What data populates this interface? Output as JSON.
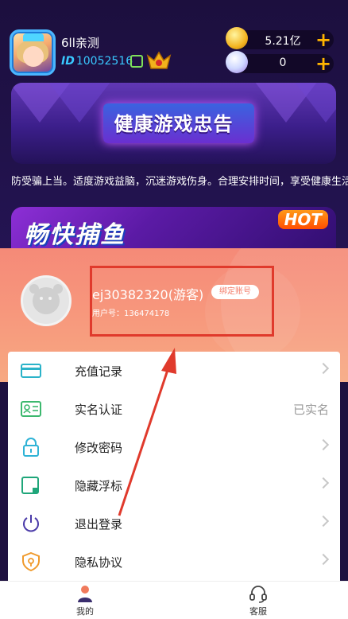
{
  "header": {
    "player_name": "6ll亲测",
    "id_label": "ID",
    "id_value": "10052516",
    "gold_value": "5.21亿",
    "pearl_value": "0",
    "plus": "+"
  },
  "banners": {
    "health_title": "健康游戏忠告",
    "notice": "防受骗上当。适度游戏益脑，沉迷游戏伤身。合理安排时间，享受健康生活。",
    "fish_title": "畅快捕鱼",
    "hot_label": "HOT"
  },
  "profile": {
    "username": "ej30382320(游客)",
    "bind_label": "绑定账号",
    "user_id": "用户号：136474178"
  },
  "menu": {
    "items": [
      {
        "label": "充值记录",
        "icon": "card-icon",
        "right": ""
      },
      {
        "label": "实名认证",
        "icon": "id-card-icon",
        "right": "已实名"
      },
      {
        "label": "修改密码",
        "icon": "lock-icon",
        "right": ""
      },
      {
        "label": "隐藏浮标",
        "icon": "float-icon",
        "right": ""
      },
      {
        "label": "退出登录",
        "icon": "power-icon",
        "right": ""
      },
      {
        "label": "隐私协议",
        "icon": "shield-icon",
        "right": ""
      }
    ]
  },
  "tabs": [
    {
      "label": "我的",
      "icon": "person-icon"
    },
    {
      "label": "客服",
      "icon": "headset-icon"
    }
  ],
  "colors": {
    "accent": "#f58a78",
    "highlight": "#e03a2c",
    "id_blue": "#39c8ff"
  }
}
